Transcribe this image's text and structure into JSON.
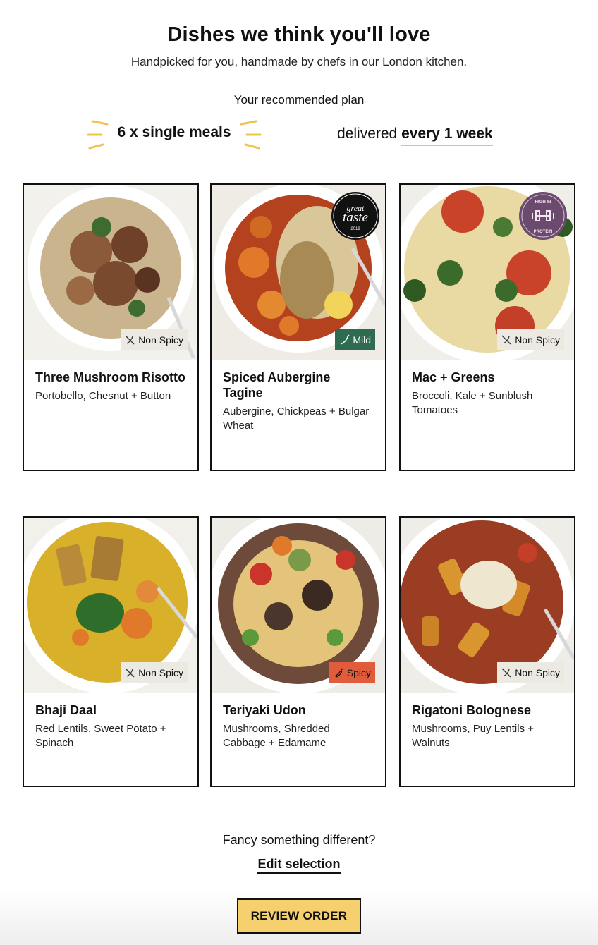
{
  "header": {
    "title": "Dishes we think you'll love",
    "subtitle": "Handpicked for you, handmade by chefs in our London kitchen."
  },
  "plan": {
    "label": "Your recommended plan",
    "meals": "6 x single meals",
    "delivered_prefix": "delivered",
    "frequency": "every 1 week"
  },
  "dishes": [
    {
      "name": "Three Mushroom Risotto",
      "description": "Portobello, Chesnut + Button",
      "spice": "Non Spicy"
    },
    {
      "name": "Spiced Aubergine Tagine",
      "description": "Aubergine, Chickpeas + Bulgar Wheat",
      "spice": "Mild",
      "award": {
        "top": "great",
        "main": "taste",
        "year": "2019"
      }
    },
    {
      "name": "Mac + Greens",
      "description": "Broccoli, Kale + Sunblush Tomatoes",
      "spice": "Non Spicy",
      "award": {
        "top": "HIGH IN",
        "bottom": "PROTEIN"
      }
    },
    {
      "name": "Bhaji Daal",
      "description": "Red Lentils, Sweet Potato + Spinach",
      "spice": "Non Spicy"
    },
    {
      "name": "Teriyaki Udon",
      "description": "Mushrooms, Shredded Cabbage + Edamame",
      "spice": "Spicy"
    },
    {
      "name": "Rigatoni Bolognese",
      "description": "Mushrooms, Puy Lentils + Walnuts",
      "spice": "Non Spicy"
    }
  ],
  "footer": {
    "prompt": "Fancy something different?",
    "edit_link": "Edit selection",
    "review_button": "REVIEW ORDER"
  },
  "colors": {
    "accent": "#f6d06e",
    "underline": "#f2c14e",
    "mild_badge": "#2e6b50",
    "spicy_badge": "#e05c3a",
    "nonspicy_badge": "#ece9e2",
    "protein_badge": "#6b4a6e"
  }
}
